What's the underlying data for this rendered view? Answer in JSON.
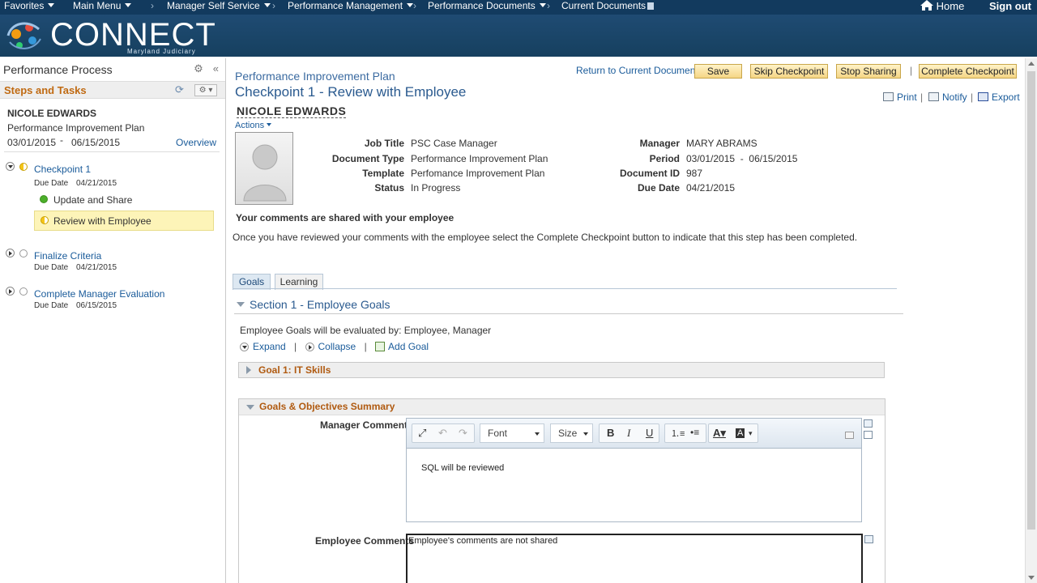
{
  "topnav": {
    "items": [
      "Favorites",
      "Main Menu",
      "Manager Self Service",
      "Performance Management",
      "Performance Documents",
      "Current Documents"
    ],
    "home": "Home",
    "signout": "Sign out"
  },
  "brand": {
    "name": "CONNECT",
    "subtitle": "Maryland Judiciary",
    "colors": {
      "nav": "#123a5e",
      "banner": "#1f4b73",
      "accent": "#c06a12"
    }
  },
  "left": {
    "title": "Performance Process",
    "steps_title": "Steps and Tasks",
    "employee": "NICOLE EDWARDS",
    "document": "Performance Improvement Plan",
    "start": "03/01/2015",
    "dash": "-",
    "end": "06/15/2015",
    "overview": "Overview",
    "due_label": "Due Date",
    "steps": [
      {
        "label": "Checkpoint 1",
        "due": "04/21/2015",
        "tasks": [
          "Update and Share",
          "Review with Employee"
        ]
      },
      {
        "label": "Finalize Criteria",
        "due": "04/21/2015"
      },
      {
        "label": "Complete Manager Evaluation",
        "due": "06/15/2015"
      }
    ]
  },
  "main": {
    "subtitle": "Performance Improvement Plan",
    "title": "Checkpoint 1 - Review with Employee",
    "return_link": "Return to Current Documents",
    "buttons": {
      "save": "Save",
      "skip": "Skip Checkpoint",
      "stop": "Stop Sharing",
      "complete": "Complete Checkpoint"
    },
    "utils": {
      "print": "Print",
      "notify": "Notify",
      "export": "Export"
    },
    "employee": "NICOLE EDWARDS",
    "actions": "Actions",
    "fields": {
      "job_title_label": "Job Title",
      "job_title": "PSC Case Manager",
      "doc_type_label": "Document Type",
      "doc_type": "Performance Improvement Plan",
      "template_label": "Template",
      "template": "Perfomance Improvement Plan",
      "status_label": "Status",
      "status": "In Progress",
      "manager_label": "Manager",
      "manager": "MARY ABRAMS",
      "period_label": "Period",
      "period": "03/01/2015  -  06/15/2015",
      "doc_id_label": "Document ID",
      "doc_id": "987",
      "due_label": "Due Date",
      "due": "04/21/2015"
    },
    "shared_note": "Your comments are shared with your employee",
    "instruction": "Once you have reviewed your comments with the employee select the Complete Checkpoint button to indicate that this step has been completed.",
    "tabs": [
      "Goals",
      "Learning"
    ],
    "section": "Section 1 - Employee Goals",
    "evaluated_by": "Employee Goals will be evaluated by: Employee, Manager",
    "expand": "Expand",
    "collapse": "Collapse",
    "add_goal": "Add Goal",
    "goal1": "Goal 1: IT Skills",
    "summary": "Goals & Objectives Summary",
    "manager_comments_label": "Manager Comments",
    "manager_comments": "SQL will be reviewed",
    "employee_comments_label": "Employee Comments",
    "employee_comments": "Employee's comments are not shared",
    "editor": {
      "font": "Font",
      "size": "Size"
    }
  }
}
